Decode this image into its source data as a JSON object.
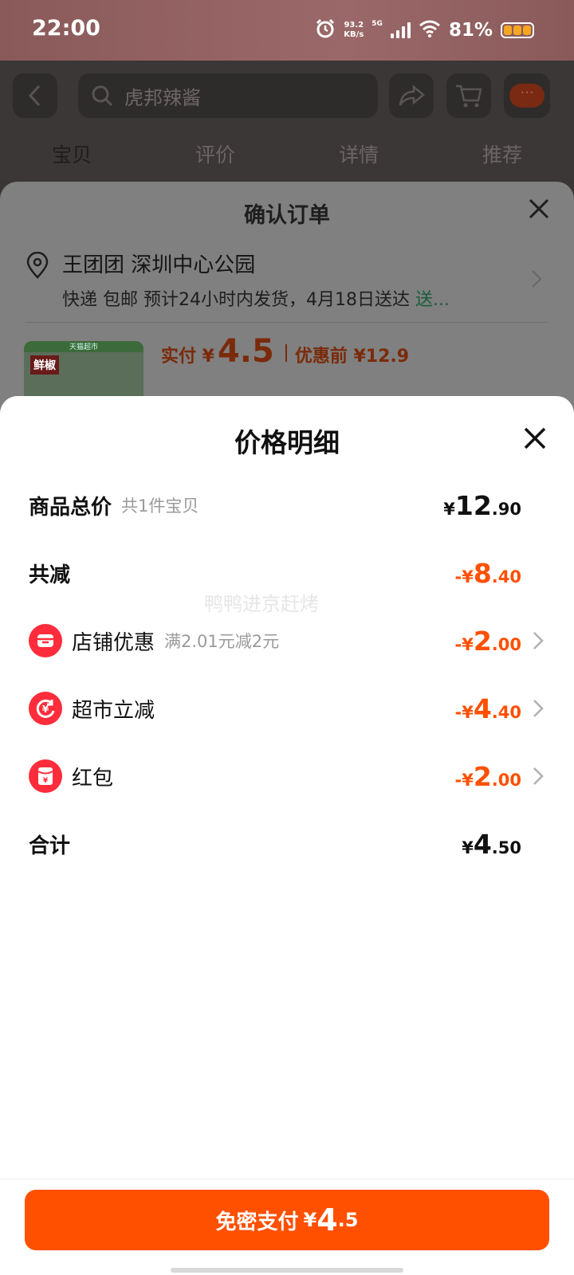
{
  "status_bar": {
    "time": "22:00",
    "net_speed_value": "93.2",
    "net_speed_unit": "KB/s",
    "network": "5G",
    "battery": "81%"
  },
  "background": {
    "search_placeholder": "虎邦辣酱",
    "tabs": [
      "宝贝",
      "评价",
      "详情",
      "推荐"
    ],
    "order_title": "确认订单",
    "address": "王团团 深圳中心公园",
    "shipping_text": "快递 包邮 预计24小时内发货，4月18日送达 ",
    "shipping_link": "送...",
    "product_badge": "鲜椒",
    "product_store": "天猫超市",
    "actual_pay_label": "实付 ¥",
    "actual_pay_value": "4.5",
    "before_discount": "优惠前 ¥12.9"
  },
  "price_detail": {
    "title": "价格明细",
    "total": {
      "label": "商品总价",
      "sub": "共1件宝贝",
      "currency": "¥",
      "int": "12",
      "dec": ".90"
    },
    "reduce": {
      "label": "共减",
      "currency": "-¥",
      "int": "8",
      "dec": ".40"
    },
    "items": [
      {
        "label": "店铺优惠",
        "sub": "满2.01元减2元",
        "currency": "-¥",
        "int": "2",
        "dec": ".00",
        "icon": "store-icon"
      },
      {
        "label": "超市立减",
        "sub": "",
        "currency": "-¥",
        "int": "4",
        "dec": ".40",
        "icon": "yuan-coin-icon"
      },
      {
        "label": "红包",
        "sub": "",
        "currency": "-¥",
        "int": "2",
        "dec": ".00",
        "icon": "red-packet-icon"
      }
    ],
    "sum": {
      "label": "合计",
      "currency": "¥",
      "int": "4",
      "dec": ".50"
    },
    "watermark": "鸭鸭进京赶烤"
  },
  "pay_button": {
    "label": "免密支付",
    "currency": "¥",
    "int": "4",
    "dec": ".5"
  },
  "colors": {
    "accent": "#ff5000",
    "icon_red": "#ff2d3b"
  }
}
